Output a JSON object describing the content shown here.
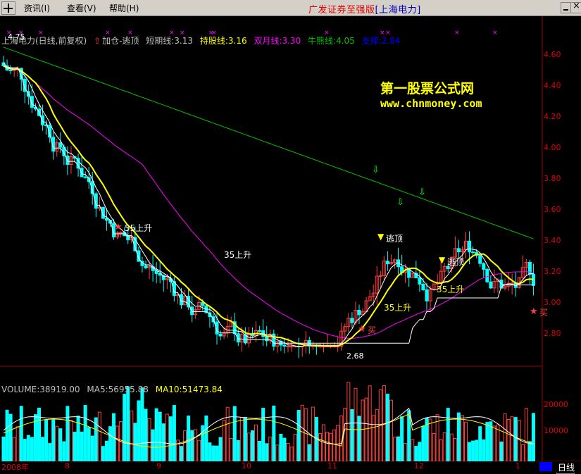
{
  "menu": {
    "items": [
      "资讯(I)",
      "查看(V)",
      "帮助(H)"
    ],
    "title_red": "广发证券至强版",
    "title_blue": "[上海电力]"
  },
  "indicators": {
    "stock_label": "上海电力(日线,前复权)",
    "formula_label": "加仓-逃顶",
    "short": "短期线:3.13",
    "hold": "持股线:3.16",
    "month": "双月线:3.30",
    "bull": "牛熊线:4.05",
    "support": "支撑:2.84"
  },
  "watermark": {
    "name": "第一股票公式网",
    "url": "www.chnmoney.com"
  },
  "price_axis": {
    "ticks": [
      "4.60",
      "4.40",
      "4.20",
      "4.00",
      "3.80",
      "3.60",
      "3.40",
      "3.20",
      "3.00",
      "2.80"
    ]
  },
  "annotations": {
    "high": "4.75",
    "low": "2.68",
    "buy": "买",
    "escape": "逃顶",
    "rise_a": "55上升",
    "rise_b": "35上升",
    "rise_c": "35上升",
    "rise_d": "35上升"
  },
  "volume": {
    "label": "VOLUME:38919.00",
    "ma5": "MA5:56955.88",
    "ma10": "MA10:51473.84",
    "ticks": [
      "20000",
      "10000"
    ],
    "scale": "X10"
  },
  "dates": [
    "2008年",
    "8",
    "9",
    "10",
    "11",
    "12",
    "1"
  ],
  "period": "日线",
  "colors": {
    "up": "#ff4040",
    "down": "#00ffff",
    "bull_line": "#00c000",
    "month_line": "#ff00ff",
    "hold_line": "#ffff00",
    "support_line": "#ffffff"
  }
}
